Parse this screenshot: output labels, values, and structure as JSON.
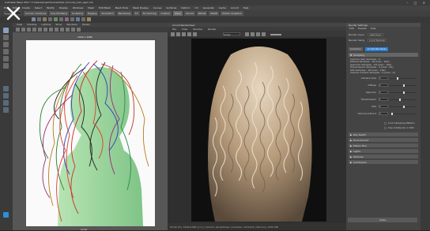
{
  "window": {
    "title": "Autodesk Maya 2017: C:\\Users\\project\\scenes\\hair_fur\\curly_hair_xgen.ma",
    "buttons": "– □ ×"
  },
  "menubar": [
    "File",
    "Edit",
    "Create",
    "Select",
    "Modify",
    "Display",
    "Windows",
    "Mesh",
    "Edit Mesh",
    "Mesh Tools",
    "Mesh Display",
    "Curves",
    "Surfaces",
    "Deform",
    "UV",
    "Generate",
    "Cache",
    "Arnold",
    "Help"
  ],
  "mode_selector": "Modeling",
  "shelf_tabs": [
    "Curves / Surfaces",
    "Poly Modeling",
    "Sculpting",
    "Rigging",
    "Animation",
    "Rendering",
    "FX",
    "FX Caching",
    "Custom",
    "XGen",
    "Arnold",
    "Bifrost",
    "MASH",
    "Motion Graphics"
  ],
  "shelf_active_tab": "XGen",
  "viewport": {
    "menu": [
      "View",
      "Shading",
      "Lighting",
      "Show",
      "Renderer",
      "Panels"
    ],
    "resolution": "1920 x 1080",
    "camera": "persp"
  },
  "render_view": {
    "title": "Arnold RenderView",
    "menu": [
      "File",
      "View",
      "Window",
      "Render"
    ],
    "camera_select": "persp",
    "status": "00:02:16 | 1920x1080 (1:1) | camera: perspShape | samples: 3/2/2/2/2 | Memory: 2450 MB"
  },
  "render_settings": {
    "title": "Render Settings",
    "menu": [
      "Edit",
      "Presets",
      "Help"
    ],
    "render_layer_label": "Render Layer",
    "render_layer": "masterLayer",
    "render_using_label": "Render Using",
    "render_using": "Arnold Renderer",
    "tabs": [
      "Common",
      "Arnold Renderer",
      "System",
      "AOVs",
      "Diagnostics"
    ],
    "active_tab": "Arnold Renderer",
    "sampling_label": "Sampling",
    "sampling_info": [
      "Camera (AA) Samples : 9",
      "Diffuse Samples : 18 (max : 162)",
      "Specular Samples : 18 (max : 162)",
      "Transmission Samples : 9 (max : 81)",
      "SSS Samples : 18 (max : 162)",
      "Volume Indirect Samples : 0 (max : 0)"
    ],
    "params": [
      {
        "label": "Camera (AA)",
        "value": "3",
        "fill": 0.3
      },
      {
        "label": "Diffuse",
        "value": "2",
        "fill": 0.55
      },
      {
        "label": "Specular",
        "value": "2",
        "fill": 0.55
      },
      {
        "label": "Transmission",
        "value": "1",
        "fill": 0.4
      },
      {
        "label": "SSS",
        "value": "2",
        "fill": 0.55
      },
      {
        "label": "Volume Indirect",
        "value": "0",
        "fill": 0.05
      }
    ],
    "checks": [
      "Lock Sampling Pattern",
      "Use Autobump in SSS"
    ],
    "sections": [
      "Ray Depth",
      "Environment",
      "Motion Blur",
      "Lights",
      "Textures",
      "Subdivision"
    ],
    "extra_sections": [
      "Filter",
      "Clamping"
    ],
    "close": "Close"
  },
  "close_overlay": "✕"
}
